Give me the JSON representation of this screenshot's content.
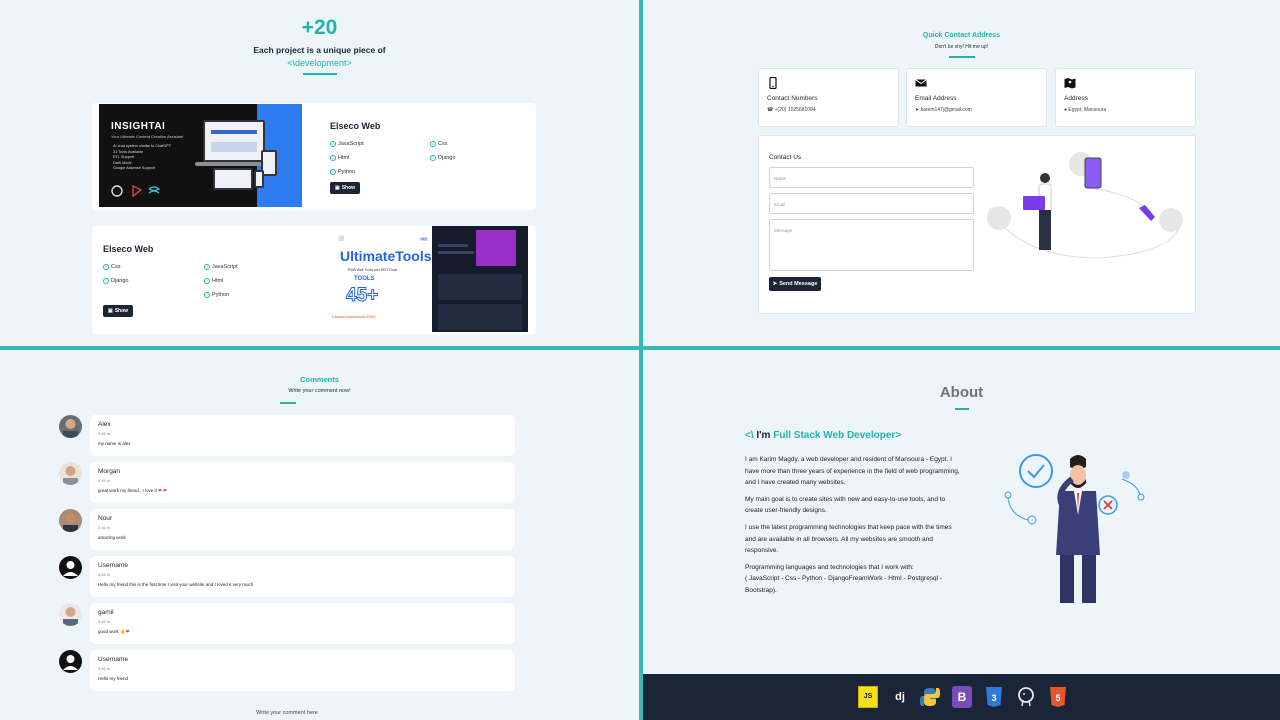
{
  "projects": {
    "count": "+20",
    "tagline": "Each project is a unique piece of",
    "highlight": "<\\development>",
    "cards": [
      {
        "title": "Elseco Web",
        "techs": [
          "JavaScript",
          "Css",
          "Html",
          "Django",
          "Python"
        ],
        "button": "Show",
        "thumb": {
          "title": "INSIGHTAI",
          "subtitle": "Your Ultimate Content Creation Assistant",
          "bullets": [
            "AI chat system similar to ChatGPT",
            "31 Tools Available",
            "RTL Support",
            "Dark Mode",
            "Google Adsense Support"
          ]
        }
      },
      {
        "title": "Elseco Web",
        "techs": [
          "Css",
          "JavaScript",
          "Django",
          "Html",
          "Python"
        ],
        "button": "Show",
        "thumb": {
          "title": "UltimateTools",
          "subtitle": "PWA Web Tools and SEO Tools",
          "tools": "TOOLS",
          "count": "45+",
          "brands": "Laravel   tailwindcss   PWA"
        }
      }
    ]
  },
  "contact": {
    "title": "Quick Contact Address",
    "subtitle": "Don't be shy! Hit me up!",
    "items": [
      {
        "icon": "phone-icon",
        "label": "Contact Numbers",
        "value": "+(20) 1025681084"
      },
      {
        "icon": "envelope-icon",
        "label": "Email Address",
        "value": "karem147j@gmail.com"
      },
      {
        "icon": "map-icon",
        "label": "Address",
        "value": "Egypt, Mansoura"
      }
    ],
    "form": {
      "title": "Contact Us",
      "name_placeholder": "Name",
      "email_placeholder": "Email",
      "message_placeholder": "Message",
      "send": "Send Message"
    }
  },
  "comments": {
    "title": "Comments",
    "subtitle": "Write your comment now!",
    "items": [
      {
        "name": "Alex",
        "time": "3:45 m",
        "text": "my name is alex",
        "avatar": "photo"
      },
      {
        "name": "Morgan",
        "time": "3:45 m",
        "text": "great work my friend.. I love it",
        "avatar": "photo"
      },
      {
        "name": "Nour",
        "time": "3:45 m",
        "text": "amazing work",
        "avatar": "photo"
      },
      {
        "name": "Username",
        "time": "3:45 m",
        "text": "Hello my friend this is the first time I visit your website and I loved it very much",
        "avatar": "default"
      },
      {
        "name": "gamil",
        "time": "3:45 m",
        "text": "good work",
        "avatar": "photo"
      },
      {
        "name": "Username",
        "time": "3:45 m",
        "text": "Hello my friend",
        "avatar": "default"
      }
    ],
    "footer": "Write your comment here"
  },
  "about": {
    "title": "About",
    "head_prefix": "<\\",
    "head_im": " I'm ",
    "head_role": "Full Stack Web Developer",
    "head_suffix": ">",
    "paragraphs": [
      "I am Karim Magdy, a web developer and resident of Mansoura - Egypt. I have more than three years of experience in the field of web programming, and I have created many websites.",
      "My main goal is to create sites with new and easy-to-use tools, and to create user-friendly designs.",
      "I use the latest programming technologies that keep pace with the times and are available in all browsers. All my websites are smooth and responsive.",
      "Programming languages and technologies that I work with:\n( JavaScript - Css - Python - DjangoFreamWork - Html - Postgresql - Bootstrap)."
    ],
    "footer_icons": [
      "javascript-icon",
      "django-icon",
      "python-icon",
      "bootstrap-icon",
      "css3-icon",
      "postgresql-icon",
      "html5-icon"
    ],
    "colors": {
      "accent": "#22b3b0",
      "navy": "#1a2538"
    }
  }
}
